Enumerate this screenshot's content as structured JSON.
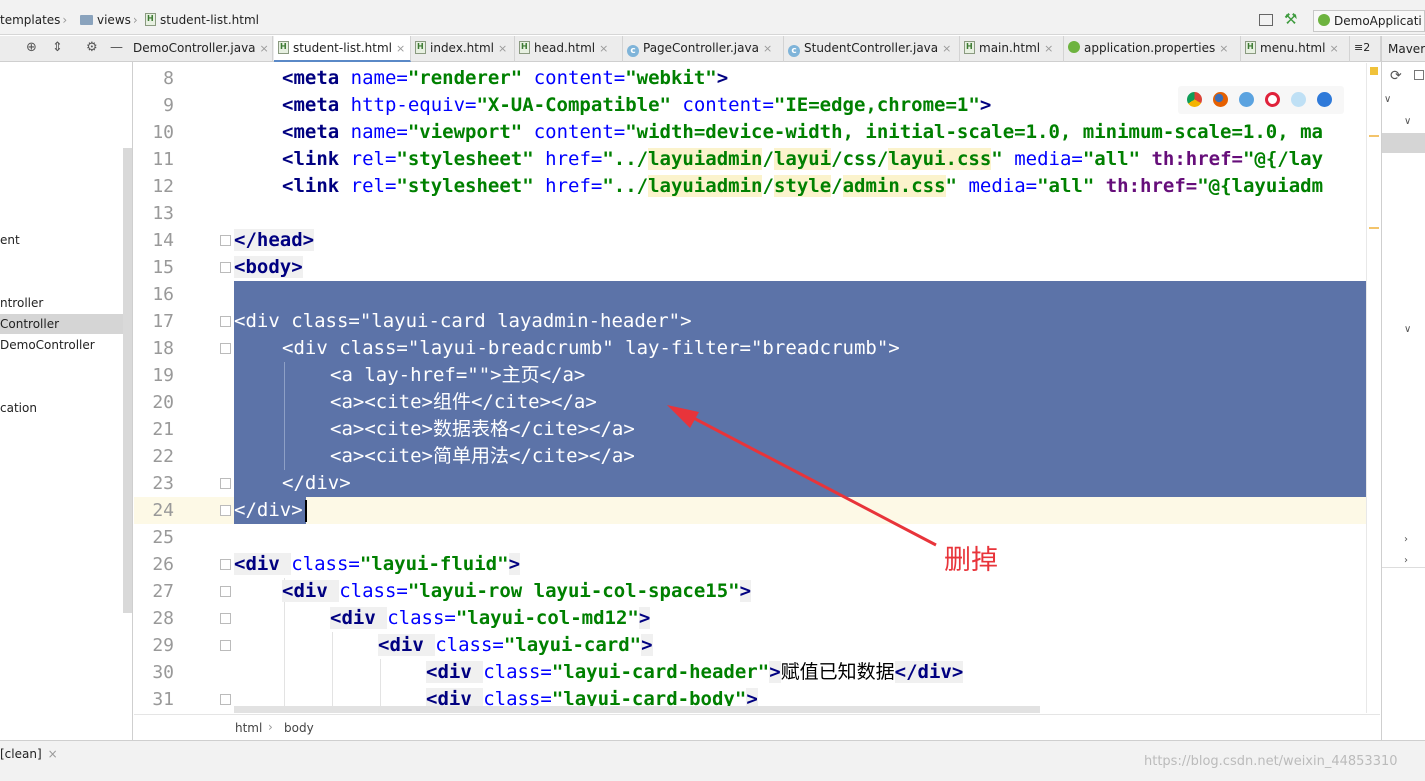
{
  "navbar": {
    "crumbs": [
      "templates",
      "views",
      "student-list.html"
    ],
    "run_config": "DemoApplicati"
  },
  "tabs": [
    {
      "label": "DemoController.java",
      "type": "class"
    },
    {
      "label": "student-list.html",
      "type": "html",
      "active": true
    },
    {
      "label": "index.html",
      "type": "html"
    },
    {
      "label": "head.html",
      "type": "html"
    },
    {
      "label": "PageController.java",
      "type": "class"
    },
    {
      "label": "StudentController.java",
      "type": "class"
    },
    {
      "label": "main.html",
      "type": "html"
    },
    {
      "label": "application.properties",
      "type": "properties"
    },
    {
      "label": "menu.html",
      "type": "html"
    }
  ],
  "tab_overflow": "≡2",
  "project_tree": [
    {
      "label": "ent"
    },
    {
      "label": "ntroller"
    },
    {
      "label": "Controller",
      "selected": true
    },
    {
      "label": "DemoController"
    },
    {
      "label": "cation"
    }
  ],
  "maven_label": "Maver",
  "editor": {
    "line_numbers": [
      "8",
      "9",
      "10",
      "11",
      "12",
      "13",
      "14",
      "15",
      "16",
      "17",
      "18",
      "19",
      "20",
      "21",
      "22",
      "23",
      "24",
      "25",
      "26",
      "27",
      "28",
      "29",
      "30",
      "31"
    ],
    "code": {
      "l8": "<meta name=\"renderer\" content=\"webkit\">",
      "l9": "<meta http-equiv=\"X-UA-Compatible\" content=\"IE=edge,chrome=1\">",
      "l10": "<meta name=\"viewport\" content=\"width=device-width, initial-scale=1.0, minimum-scale=1.0, ma",
      "l11": "<link rel=\"stylesheet\" href=\"../layuiadmin/layui/css/layui.css\" media=\"all\" th:href=\"@{/lay",
      "l12": "<link rel=\"stylesheet\" href=\"../layuiadmin/style/admin.css\" media=\"all\" th:href=\"@{layuiadm",
      "l14": "</head>",
      "l15": "<body>",
      "l17": "<div class=\"layui-card layadmin-header\">",
      "l18": "<div class=\"layui-breadcrumb\" lay-filter=\"breadcrumb\">",
      "l19": "<a lay-href=\"\">主页</a>",
      "l20": "<a><cite>组件</cite></a>",
      "l21": "<a><cite>数据表格</cite></a>",
      "l22": "<a><cite>简单用法</cite></a>",
      "l23": "</div>",
      "l24": "</div>",
      "l26": "<div class=\"layui-fluid\">",
      "l27": "<div class=\"layui-row layui-col-space15\">",
      "l28": "<div class=\"layui-col-md12\">",
      "l29": "<div class=\"layui-card\">",
      "l30": "<div class=\"layui-card-header\">赋值已知数据</div>",
      "l31": "<div class=\"layui-card-body\">"
    }
  },
  "annotation": "删掉",
  "editor_breadcrumbs": [
    "html",
    "body"
  ],
  "status": {
    "left": "[clean]",
    "watermark": "https://blog.csdn.net/weixin_44853310"
  },
  "colors": {
    "selection": "#5c73a8",
    "tag": "#000080",
    "attr": "#0000ff",
    "value": "#008000",
    "annotation": "#e8343a"
  }
}
